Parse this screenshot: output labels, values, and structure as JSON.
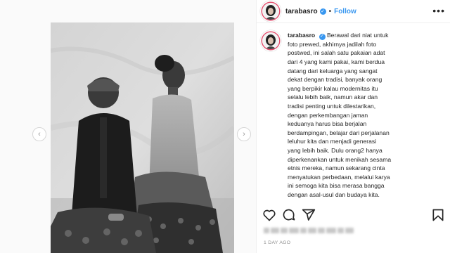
{
  "post": {
    "username": "tarabasro",
    "verified": true,
    "follow_label": "Follow",
    "more_label": "•••",
    "caption_username": "tarabasro",
    "caption_lines": [
      "Berawal dari niat untuk",
      "foto prewed, akhirnya jadilah foto",
      "postwed, ini salah satu pakaian adat",
      "dari 4 yang kami pakai, kami berdua",
      "datang dari keluarga yang sangat",
      "dekat dengan tradisi, banyak orang",
      "yang berpikir kalau modernitas itu",
      "selalu lebih baik, namun akar dan",
      "tradisi penting untuk dilestarikan,",
      "dengan perkembangan jaman",
      "keduanya harus bisa berjalan",
      "berdampingan, belajar dari perjalanan",
      "leluhur kita dan menjadi generasi",
      "yang lebih baik. Dulu orang2 hanya",
      "diperkenankan untuk menikah sesama",
      "etnis mereka, namun sekarang cinta",
      "menyatukan perbedaan, melalui karya",
      "ini semoga kita bisa merasa bangga",
      "dengan asal-usul dan budaya kita."
    ],
    "date": "1 DAY AGO"
  },
  "icons": {
    "like": "heart-icon",
    "comment": "comment-icon",
    "share": "share-icon",
    "save": "bookmark-icon",
    "prev": "chevron-left-icon",
    "next": "chevron-right-icon"
  },
  "colors": {
    "link": "#3897f0",
    "text": "#262626",
    "muted": "#8e8e8e"
  }
}
